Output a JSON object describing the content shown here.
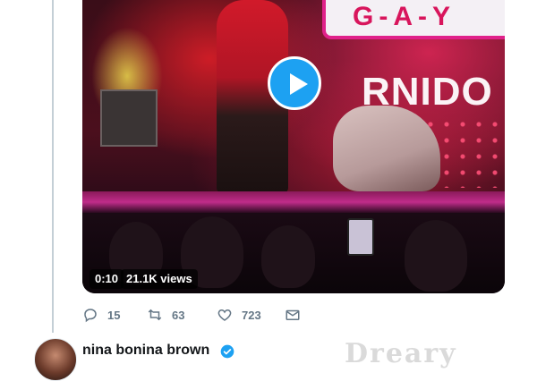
{
  "video": {
    "duration": "0:10",
    "views": "21.1K views",
    "sign_text": "G-A-Y",
    "stage_text": "RNIDO",
    "play_icon": "play-icon"
  },
  "actions": {
    "replies": "15",
    "retweets": "63",
    "likes": "723"
  },
  "next_tweet": {
    "author": "nina bonina brown",
    "verified": true
  },
  "watermark": "Dreary",
  "colors": {
    "accent": "#1da1f2",
    "muted": "#657786",
    "text": "#14171a",
    "verified": "#1da1f2"
  }
}
